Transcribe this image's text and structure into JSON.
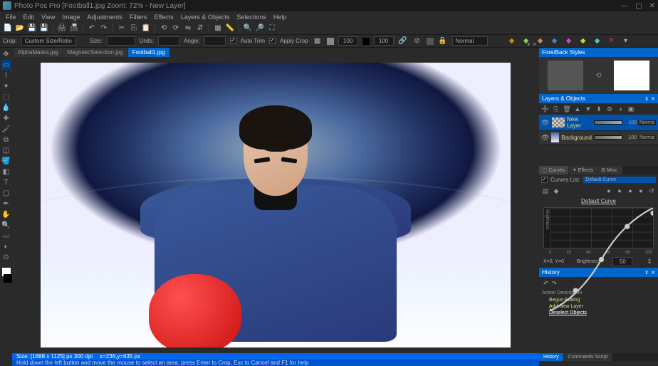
{
  "window": {
    "title": "Photo Pos Pro [Football1.jpg Zoom: 72% - New Layer]",
    "minimize": "—",
    "maximize": "▢",
    "close": "✕"
  },
  "menu": [
    "File",
    "Edit",
    "View",
    "Image",
    "Adjustments",
    "Filters",
    "Effects",
    "Layers & Objects",
    "Selections",
    "Help"
  ],
  "optbar": {
    "crop_label": "Crop:",
    "crop_mode": "Custom Size/Ratio",
    "size_label": "Size:",
    "units_label": "Units:",
    "angle_label": "Angle:",
    "autotrim": "Auto Trim",
    "applycrop": "Apply Crop",
    "val1": "100",
    "val2": "100",
    "blend": "Normal"
  },
  "tabs": [
    "AlphaMasks.jpg",
    "MagneticSelection.jpg",
    "Football1.jpg"
  ],
  "active_tab": 2,
  "status": {
    "size": "Size: [1688 x 1125] px 300 dpi",
    "pos": "x=236,y=635 px",
    "help": "Hold down the left button and move the mouse to select an area, press Enter to Crop, Esc to Cancel and F1 for help"
  },
  "panels": {
    "styles_title": "Fore/Back Styles",
    "layers_title": "Layers & Objects",
    "layers": [
      {
        "name": "New Layer",
        "opacity": "100",
        "mode": "Norma"
      },
      {
        "name": "Background",
        "opacity": "100",
        "mode": "Norma"
      }
    ],
    "curves_tabs": [
      "Curves",
      "Effects",
      "Misc."
    ],
    "curves_list_label": "Curves List:",
    "curve_selected": "Default Curve",
    "curve_title": "Default Curve",
    "ylabel": "Brightness",
    "xlabel": "Brightness",
    "ticks": [
      "0",
      "20",
      "40",
      "60",
      "80",
      "100"
    ],
    "xy": "X=0, Y=0",
    "bright_val": "50",
    "history_title": "History",
    "action_desc": "Action Description",
    "history": [
      "Begun Editing",
      "Add New Layer",
      "Deselect Objects"
    ],
    "bottom_tabs": [
      "History",
      "Commands Script"
    ]
  }
}
